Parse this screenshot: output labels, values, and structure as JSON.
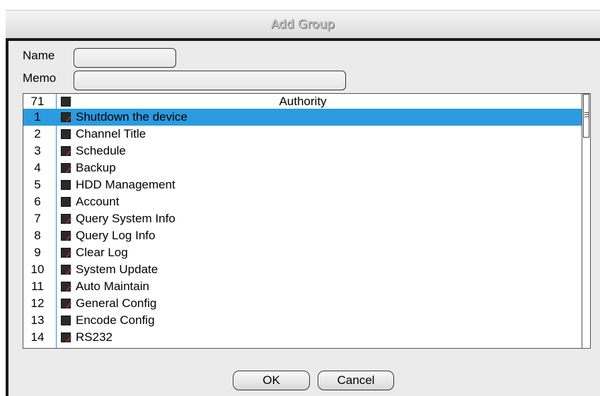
{
  "dialog": {
    "title": "Add Group"
  },
  "form": {
    "name_label": "Name",
    "name_value": "",
    "memo_label": "Memo",
    "memo_value": ""
  },
  "authority_list": {
    "header": {
      "count": "71",
      "label": "Authority",
      "checked": false
    },
    "selected_index": 0,
    "items": [
      {
        "num": "1",
        "label": "Shutdown the device",
        "checked": true
      },
      {
        "num": "2",
        "label": "Channel Title",
        "checked": false
      },
      {
        "num": "3",
        "label": "Schedule",
        "checked": true
      },
      {
        "num": "4",
        "label": "Backup",
        "checked": true
      },
      {
        "num": "5",
        "label": "HDD Management",
        "checked": false
      },
      {
        "num": "6",
        "label": "Account",
        "checked": false
      },
      {
        "num": "7",
        "label": "Query System Info",
        "checked": true
      },
      {
        "num": "8",
        "label": "Query Log Info",
        "checked": true
      },
      {
        "num": "9",
        "label": "Clear Log",
        "checked": true
      },
      {
        "num": "10",
        "label": "System Update",
        "checked": true
      },
      {
        "num": "11",
        "label": "Auto Maintain",
        "checked": true
      },
      {
        "num": "12",
        "label": "General Config",
        "checked": true
      },
      {
        "num": "13",
        "label": "Encode Config",
        "checked": false
      },
      {
        "num": "14",
        "label": "RS232",
        "checked": true
      }
    ]
  },
  "buttons": {
    "ok_label": "OK",
    "cancel_label": "Cancel"
  }
}
